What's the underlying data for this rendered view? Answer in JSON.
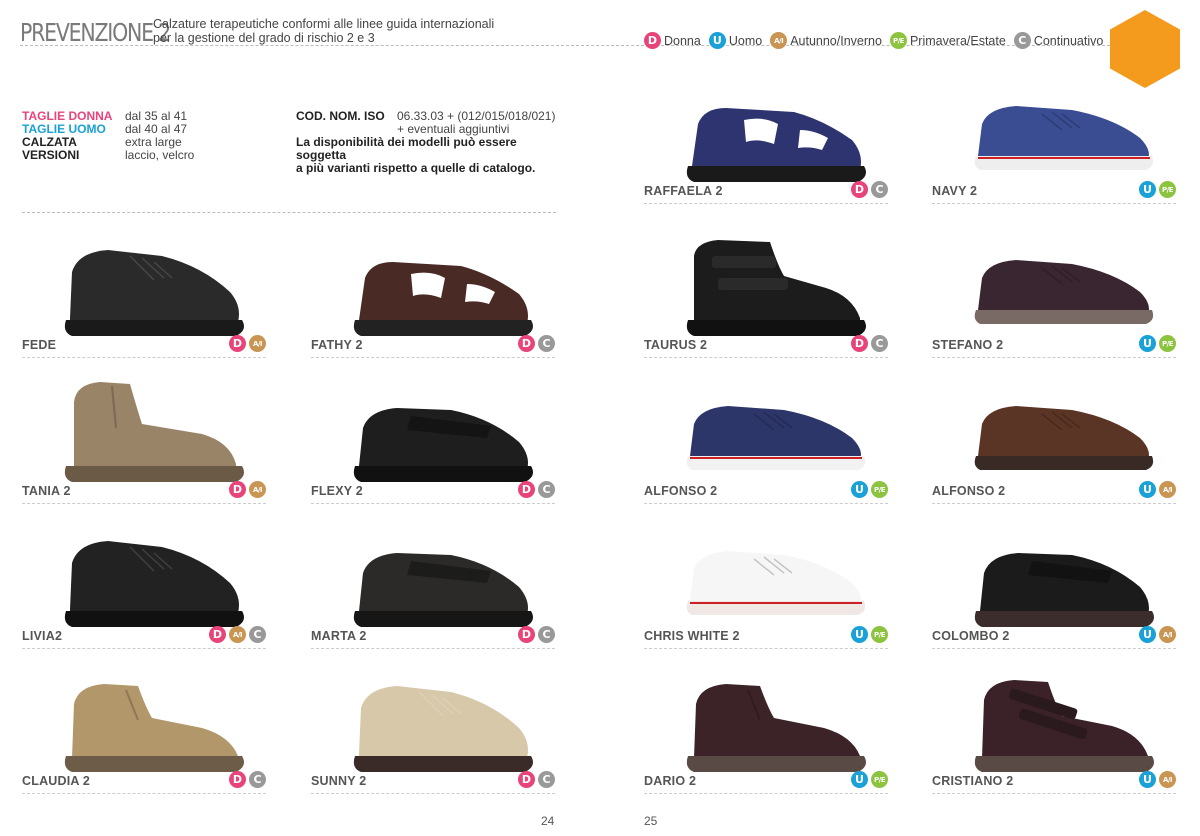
{
  "header": {
    "brand": "PREVENZIONE 2",
    "subtitle_line1": "Calzature terapeutiche conformi alle linee guida internazionali",
    "subtitle_line2": "per la gestione del grado di rischio 2 e 3"
  },
  "legend": [
    {
      "code": "D",
      "label": "Donna"
    },
    {
      "code": "U",
      "label": "Uomo"
    },
    {
      "code": "A/I",
      "label": "Autunno/Inverno"
    },
    {
      "code": "P/E",
      "label": "Primavera/Estate"
    },
    {
      "code": "C",
      "label": "Continuativo"
    }
  ],
  "colors": {
    "D": "#e9447a",
    "U": "#1aa1d7",
    "A/I": "#c99552",
    "P/E": "#8cc43f",
    "C": "#999999",
    "accent": "#f49a1c"
  },
  "specs": {
    "taglie_donna_label": "TAGLIE DONNA",
    "taglie_donna_value": "dal 35 al 41",
    "taglie_uomo_label": "TAGLIE UOMO",
    "taglie_uomo_value": "dal 40 al 47",
    "calzata_label": "CALZATA",
    "calzata_value": "extra large",
    "versioni_label": "VERSIONI",
    "versioni_value": "laccio, velcro"
  },
  "iso": {
    "label": "COD. NOM. ISO",
    "value": "06.33.03 + (012/015/018/021)",
    "extra": "+ eventuali aggiuntivi",
    "note_line1": "La disponibilità dei modelli può essere soggetta",
    "note_line2": "a più varianti rispetto a quelle di catalogo."
  },
  "products": [
    {
      "name": "FEDE",
      "badges": [
        "D",
        "A/I"
      ],
      "shoe": "sneaker",
      "colors": [
        "#2a2a2a",
        "#1a1a1a"
      ]
    },
    {
      "name": "FATHY 2",
      "badges": [
        "D",
        "C"
      ],
      "shoe": "sandal",
      "colors": [
        "#4a2a25",
        "#222"
      ]
    },
    {
      "name": "TANIA 2",
      "badges": [
        "D",
        "A/I"
      ],
      "shoe": "boot",
      "colors": [
        "#9a8468",
        "#6b5a45"
      ]
    },
    {
      "name": "FLEXY 2",
      "badges": [
        "D",
        "C"
      ],
      "shoe": "velcro",
      "colors": [
        "#1e1e1e",
        "#111"
      ]
    },
    {
      "name": "LIVIA2",
      "badges": [
        "D",
        "A/I",
        "C"
      ],
      "shoe": "sneaker",
      "colors": [
        "#222",
        "#111"
      ]
    },
    {
      "name": "MARTA 2",
      "badges": [
        "D",
        "C"
      ],
      "shoe": "velcro",
      "colors": [
        "#2b2a28",
        "#161616"
      ]
    },
    {
      "name": "CLAUDIA 2",
      "badges": [
        "D",
        "C"
      ],
      "shoe": "chukka",
      "colors": [
        "#b1976a",
        "#6d5d48"
      ]
    },
    {
      "name": "SUNNY 2",
      "badges": [
        "D",
        "C"
      ],
      "shoe": "sneaker",
      "colors": [
        "#d8c8aa",
        "#3a2a28"
      ]
    },
    {
      "name": "RAFFAELA 2",
      "badges": [
        "D",
        "C"
      ],
      "shoe": "sandal",
      "colors": [
        "#2e3470",
        "#1a1a1a"
      ]
    },
    {
      "name": "NAVY 2",
      "badges": [
        "U",
        "P/E"
      ],
      "shoe": "lowsneaker",
      "colors": [
        "#3a4c92",
        "#eeeeee"
      ]
    },
    {
      "name": "TAURUS 2",
      "badges": [
        "D",
        "C"
      ],
      "shoe": "hightop",
      "colors": [
        "#1c1c1c",
        "#111"
      ]
    },
    {
      "name": "STEFANO 2",
      "badges": [
        "U",
        "P/E"
      ],
      "shoe": "lowsneaker",
      "colors": [
        "#3a2630",
        "#7a6a66"
      ]
    },
    {
      "name": "ALFONSO 2",
      "badges": [
        "U",
        "P/E"
      ],
      "shoe": "lowsneaker",
      "colors": [
        "#2d3668",
        "#f2f2f2"
      ]
    },
    {
      "name": "ALFONSO 2",
      "badges": [
        "U",
        "A/I"
      ],
      "shoe": "lowsneaker",
      "colors": [
        "#5a3424",
        "#3a2a26"
      ]
    },
    {
      "name": "CHRIS WHITE 2",
      "badges": [
        "U",
        "P/E"
      ],
      "shoe": "lowsneaker",
      "colors": [
        "#f6f6f6",
        "#efe8e4"
      ]
    },
    {
      "name": "COLOMBO 2",
      "badges": [
        "U",
        "A/I"
      ],
      "shoe": "velcro",
      "colors": [
        "#1b1b1b",
        "#3b2d2b"
      ]
    },
    {
      "name": "DARIO 2",
      "badges": [
        "U",
        "P/E"
      ],
      "shoe": "chukka",
      "colors": [
        "#3c2328",
        "#5a4a46"
      ]
    },
    {
      "name": "CRISTIANO 2",
      "badges": [
        "U",
        "A/I"
      ],
      "shoe": "velcrochukka",
      "colors": [
        "#3a2228",
        "#5a4a46"
      ]
    }
  ],
  "pages": {
    "left": "24",
    "right": "25"
  }
}
